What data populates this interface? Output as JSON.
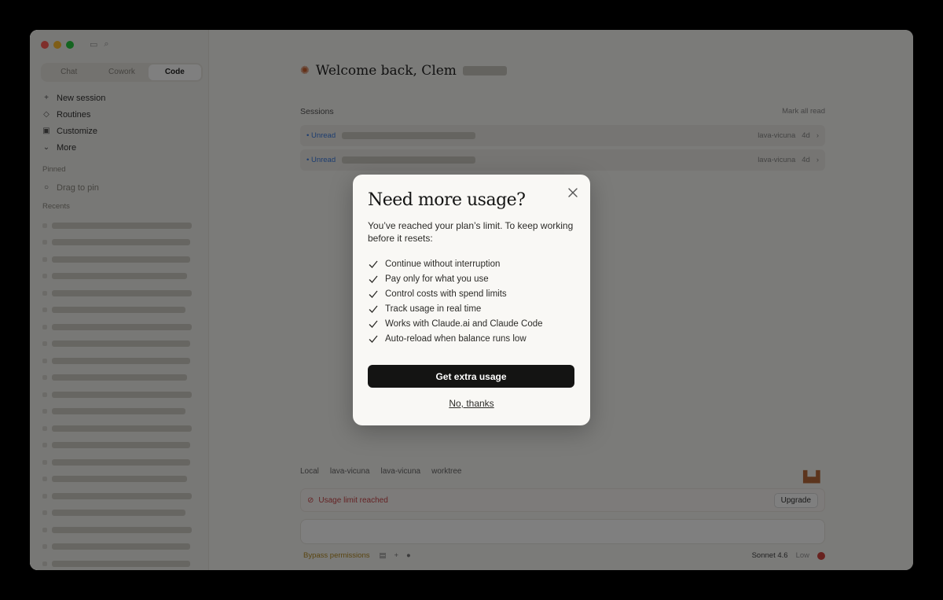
{
  "sidebar": {
    "mode_tabs": [
      {
        "label": "Chat",
        "icon": "chat-bubble-icon"
      },
      {
        "label": "Cowork",
        "icon": "cowork-icon"
      },
      {
        "label": "Code",
        "icon": "code-icon"
      }
    ],
    "nav": [
      {
        "label": "New session",
        "icon": "plus-icon"
      },
      {
        "label": "Routines",
        "icon": "routines-icon"
      },
      {
        "label": "Customize",
        "icon": "customize-icon"
      },
      {
        "label": "More",
        "icon": "chevron-down-icon"
      }
    ],
    "pinned_label": "Pinned",
    "drag_to_pin": "Drag to pin",
    "recents_label": "Recents"
  },
  "main": {
    "welcome": "Welcome back, Clem",
    "sessions_label": "Sessions",
    "mark_all_read": "Mark all read",
    "sessions": [
      {
        "status": "Unread",
        "repo": "lava-vicuna",
        "age": "4d"
      },
      {
        "status": "Unread",
        "repo": "lava-vicuna",
        "age": "4d"
      }
    ],
    "bottom_bar": [
      "Local",
      "lava-vicuna",
      "lava-vicuna",
      "worktree"
    ],
    "usage_limit": "Usage limit reached",
    "upgrade": "Upgrade",
    "bypass": "Bypass permissions",
    "model": "Sonnet 4.6",
    "effort": "Low"
  },
  "modal": {
    "title": "Need more usage?",
    "subtitle": "You’ve reached your plan’s limit. To keep working before it resets:",
    "features": [
      "Continue without interruption",
      "Pay only for what you use",
      "Control costs with spend limits",
      "Track usage in real time",
      "Works with Claude.ai and Claude Code",
      "Auto-reload when balance runs low"
    ],
    "cta": "Get extra usage",
    "decline": "No, thanks"
  },
  "colors": {
    "cta_bg": "#141413",
    "modal_bg": "#f9f8f5",
    "usage_limit_text": "#c9464a",
    "unread": "#3b7be0"
  }
}
